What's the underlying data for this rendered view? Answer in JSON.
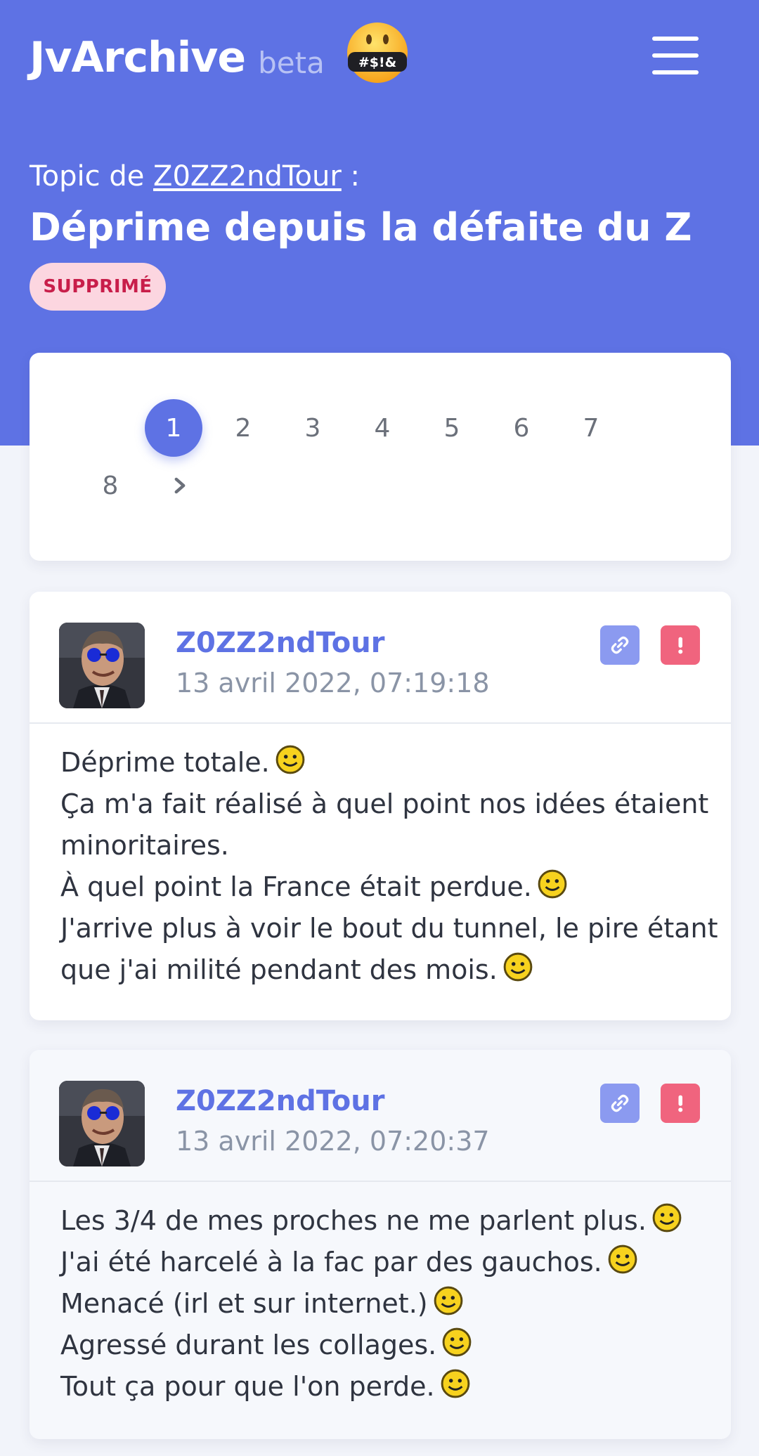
{
  "header": {
    "logo": "JvArchive",
    "logo_suffix": "beta",
    "logo_emoji": "#$!&"
  },
  "topic": {
    "prefix": "Topic de",
    "author": "Z0ZZ2ndTour",
    "suffix": ":",
    "title": "Déprime depuis la défaite du Z",
    "status_badge": "SUPPRIMÉ"
  },
  "pagination": {
    "pages": [
      "1",
      "2",
      "3",
      "4",
      "5",
      "6",
      "7",
      "8"
    ],
    "current": "1"
  },
  "posts": [
    {
      "author": "Z0ZZ2ndTour",
      "date": "13 avril 2022, 07:19:18",
      "lines": [
        {
          "text": "Déprime totale.",
          "smiley": true
        },
        {
          "text": "Ça m'a fait réalisé à quel point nos idées étaient",
          "smiley": false
        },
        {
          "text": "minoritaires.",
          "smiley": false
        },
        {
          "text": "À quel point la France était perdue.",
          "smiley": true
        },
        {
          "text": "J'arrive plus à voir le bout du tunnel, le pire étant",
          "smiley": false
        },
        {
          "text": "que j'ai milité pendant des mois.",
          "smiley": true
        }
      ]
    },
    {
      "author": "Z0ZZ2ndTour",
      "date": "13 avril 2022, 07:20:37",
      "lines": [
        {
          "text": "Les 3/4 de mes proches ne me parlent plus.",
          "smiley": true
        },
        {
          "text": "J'ai été harcelé à la fac par des gauchos.",
          "smiley": true
        },
        {
          "text": "Menacé (irl et sur internet.)",
          "smiley": true
        },
        {
          "text": "Agressé durant les collages.",
          "smiley": true
        },
        {
          "text": "Tout ça pour que l'on perde.",
          "smiley": true
        }
      ]
    }
  ],
  "colors": {
    "primary": "#5e72e4",
    "badge_bg": "#fcd6e0",
    "badge_text": "#c81e4a",
    "report": "#f0647e",
    "link": "#8b9af0"
  }
}
